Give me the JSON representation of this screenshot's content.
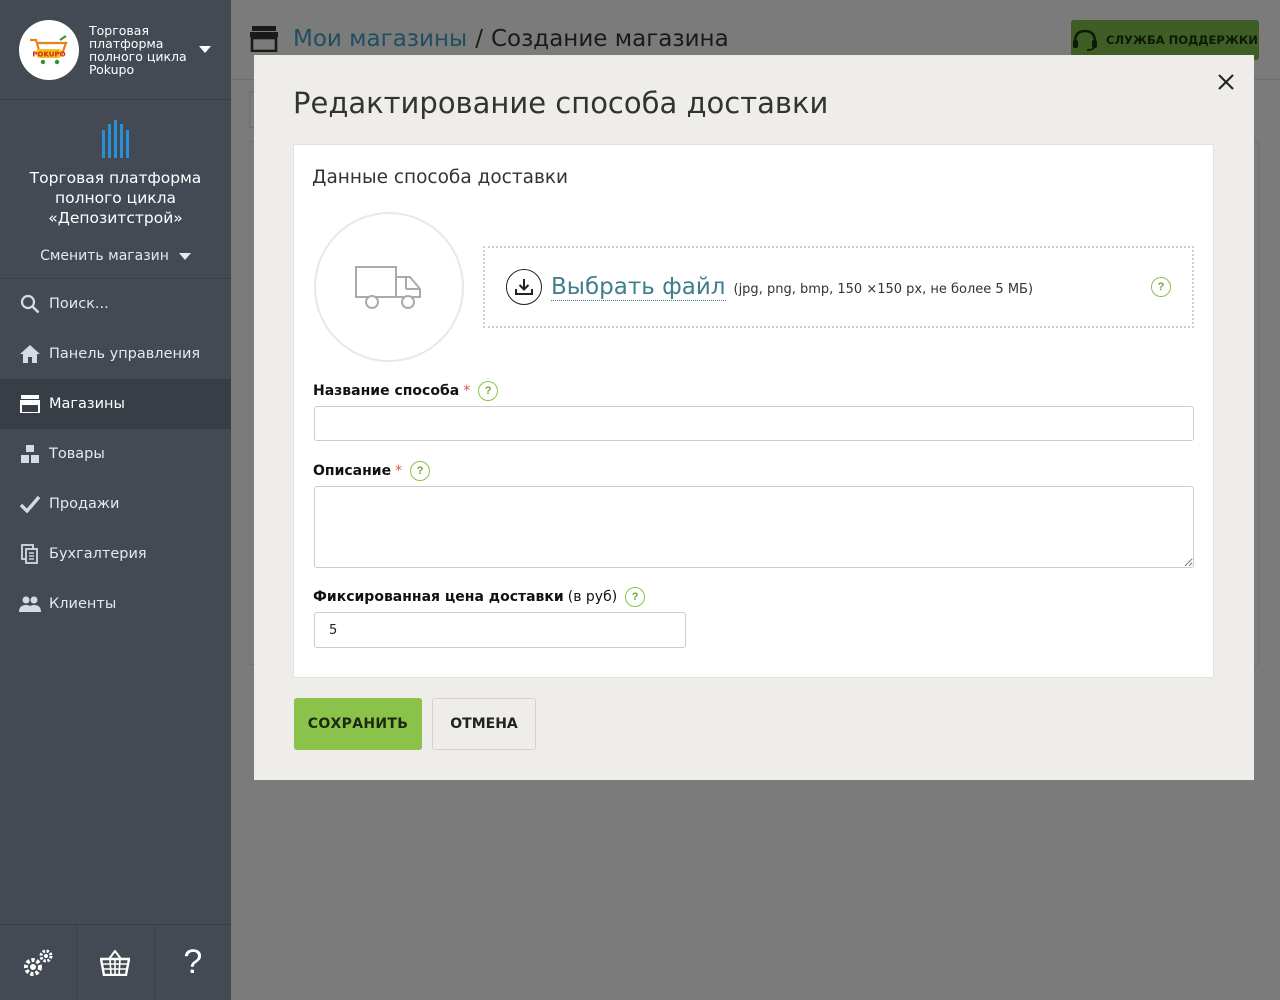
{
  "sidebar": {
    "org_name": "Торговая платформа полного цикла Pokupo",
    "store_name": "Торговая платформа полного цикла «Депозитстрой»",
    "switch_store": "Сменить магазин",
    "nav": [
      {
        "label": "Поиск...",
        "icon": "search-icon"
      },
      {
        "label": "Панель управления",
        "icon": "home-icon"
      },
      {
        "label": "Магазины",
        "icon": "store-icon"
      },
      {
        "label": "Товары",
        "icon": "boxes-icon"
      },
      {
        "label": "Продажи",
        "icon": "check-icon"
      },
      {
        "label": "Бухгалтерия",
        "icon": "documents-icon"
      },
      {
        "label": "Клиенты",
        "icon": "users-icon"
      }
    ],
    "bottom": {
      "help": "?"
    }
  },
  "header": {
    "breadcrumb_link": "Мои магазины",
    "breadcrumb_sep": "/",
    "breadcrumb_current": "Создание магазина",
    "support_label": "СЛУЖБА ПОДДЕРЖКИ"
  },
  "modal": {
    "title": "Редактирование способа доставки",
    "card_title": "Данные способа доставки",
    "upload": {
      "link": "Выбрать файл",
      "hint": "(jpg, png, bmp, 150 ×150 px, не более 5 МБ)"
    },
    "fields": {
      "name_label": "Название способа",
      "name_value": "",
      "desc_label": "Описание",
      "desc_value": "",
      "price_label": "Фиксированная цена доставки",
      "price_unit": "(в руб)",
      "price_value": "5",
      "required_mark": "*",
      "help_mark": "?"
    },
    "buttons": {
      "save": "СОХРАНИТЬ",
      "cancel": "ОТМЕНА"
    }
  },
  "colors": {
    "sidebar_bg": "#434a54",
    "accent_green": "#8bc34a",
    "link_teal": "#3f7f8c",
    "modal_bg": "#efedea",
    "overlay": "#7b7b7b"
  }
}
